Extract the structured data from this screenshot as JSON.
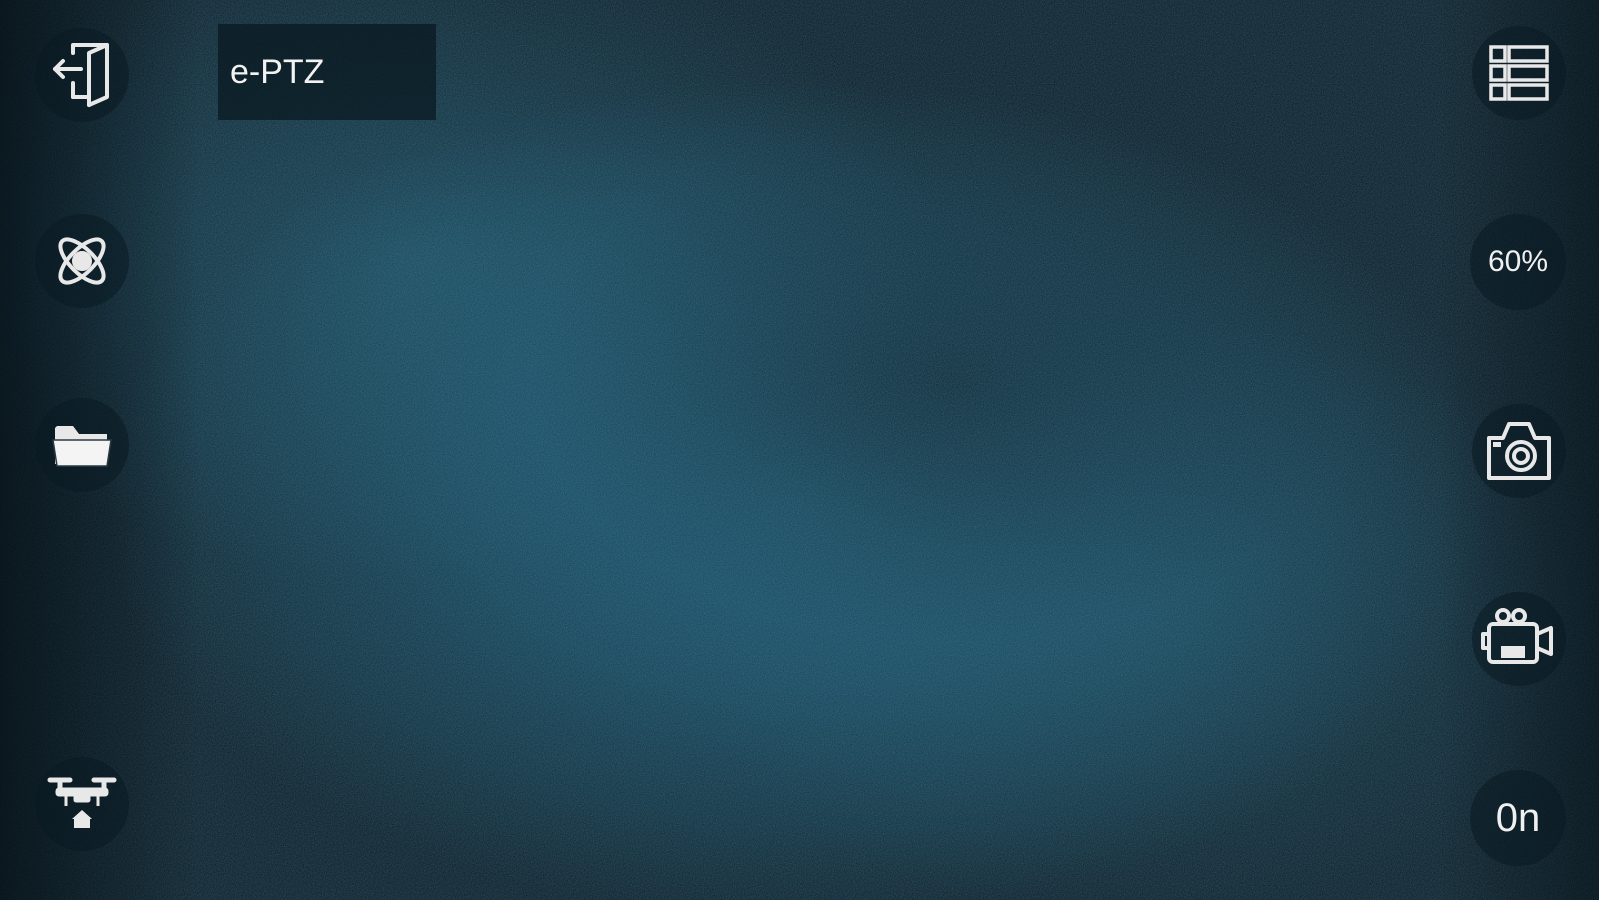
{
  "top_bar": {
    "mode_label": "e-PTZ"
  },
  "left_toolbar": {
    "items": [
      {
        "icon": "exit-icon"
      },
      {
        "icon": "drone-propeller-icon"
      },
      {
        "icon": "folder-icon"
      },
      {
        "icon": "drone-home-icon"
      }
    ]
  },
  "right_toolbar": {
    "zoom_level": "60%",
    "shutter_value": "0n",
    "items": [
      {
        "icon": "list-menu-icon"
      },
      {
        "icon": "camera-icon"
      },
      {
        "icon": "video-camera-icon"
      }
    ]
  },
  "colors": {
    "background": "#0f3e54",
    "icon": "#e8e8e8",
    "button_bg": "#0a1a22"
  }
}
